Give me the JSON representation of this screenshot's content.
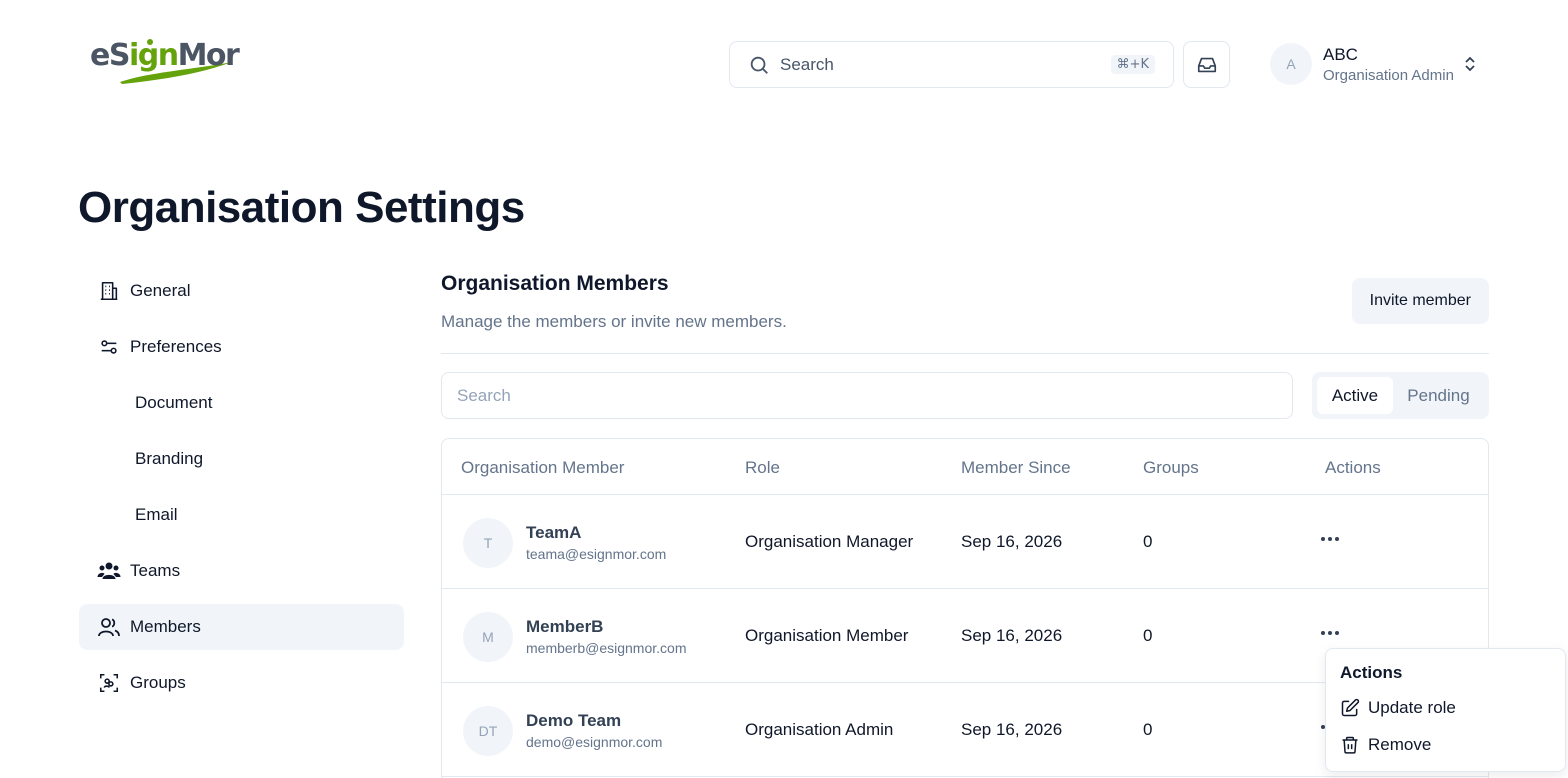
{
  "header": {
    "logo_text_prefix": "eS",
    "logo_text_accent": "ign",
    "logo_text_suffix": "Mor",
    "search_label": "Search",
    "search_shortcut": "⌘+K",
    "user": {
      "initial": "A",
      "name": "ABC",
      "role": "Organisation Admin"
    }
  },
  "page": {
    "title": "Organisation Settings"
  },
  "sidebar": {
    "items": [
      {
        "label": "General",
        "icon": "building-icon"
      },
      {
        "label": "Preferences",
        "icon": "settings-sliders-icon"
      },
      {
        "label": "Document"
      },
      {
        "label": "Branding"
      },
      {
        "label": "Email"
      },
      {
        "label": "Teams",
        "icon": "users-icon"
      },
      {
        "label": "Members",
        "icon": "user-icon",
        "active": true
      },
      {
        "label": "Groups",
        "icon": "group-scan-icon"
      }
    ]
  },
  "main": {
    "title": "Organisation Members",
    "description": "Manage the members or invite new members.",
    "invite_label": "Invite member",
    "search_placeholder": "Search",
    "tabs": [
      {
        "label": "Active",
        "active": true
      },
      {
        "label": "Pending",
        "active": false
      }
    ],
    "table": {
      "headers": [
        "Organisation Member",
        "Role",
        "Member Since",
        "Groups",
        "Actions"
      ],
      "rows": [
        {
          "initials": "T",
          "name": "TeamA",
          "email": "teama@esignmor.com",
          "role": "Organisation Manager",
          "since": "Sep 16, 2026",
          "groups": "0"
        },
        {
          "initials": "M",
          "name": "MemberB",
          "email": "memberb@esignmor.com",
          "role": "Organisation Member",
          "since": "Sep 16, 2026",
          "groups": "0"
        },
        {
          "initials": "DT",
          "name": "Demo Team",
          "email": "demo@esignmor.com",
          "role": "Organisation Admin",
          "since": "Sep 16, 2026",
          "groups": "0"
        }
      ]
    }
  },
  "dropdown": {
    "title": "Actions",
    "items": [
      {
        "label": "Update role",
        "icon": "edit-icon"
      },
      {
        "label": "Remove",
        "icon": "trash-icon"
      }
    ]
  },
  "colors": {
    "brand_green": "#65a30d",
    "brand_gray": "#4b5563",
    "muted_bg": "#f1f5f9",
    "border": "#e2e8f0",
    "muted_text": "#64748b"
  }
}
